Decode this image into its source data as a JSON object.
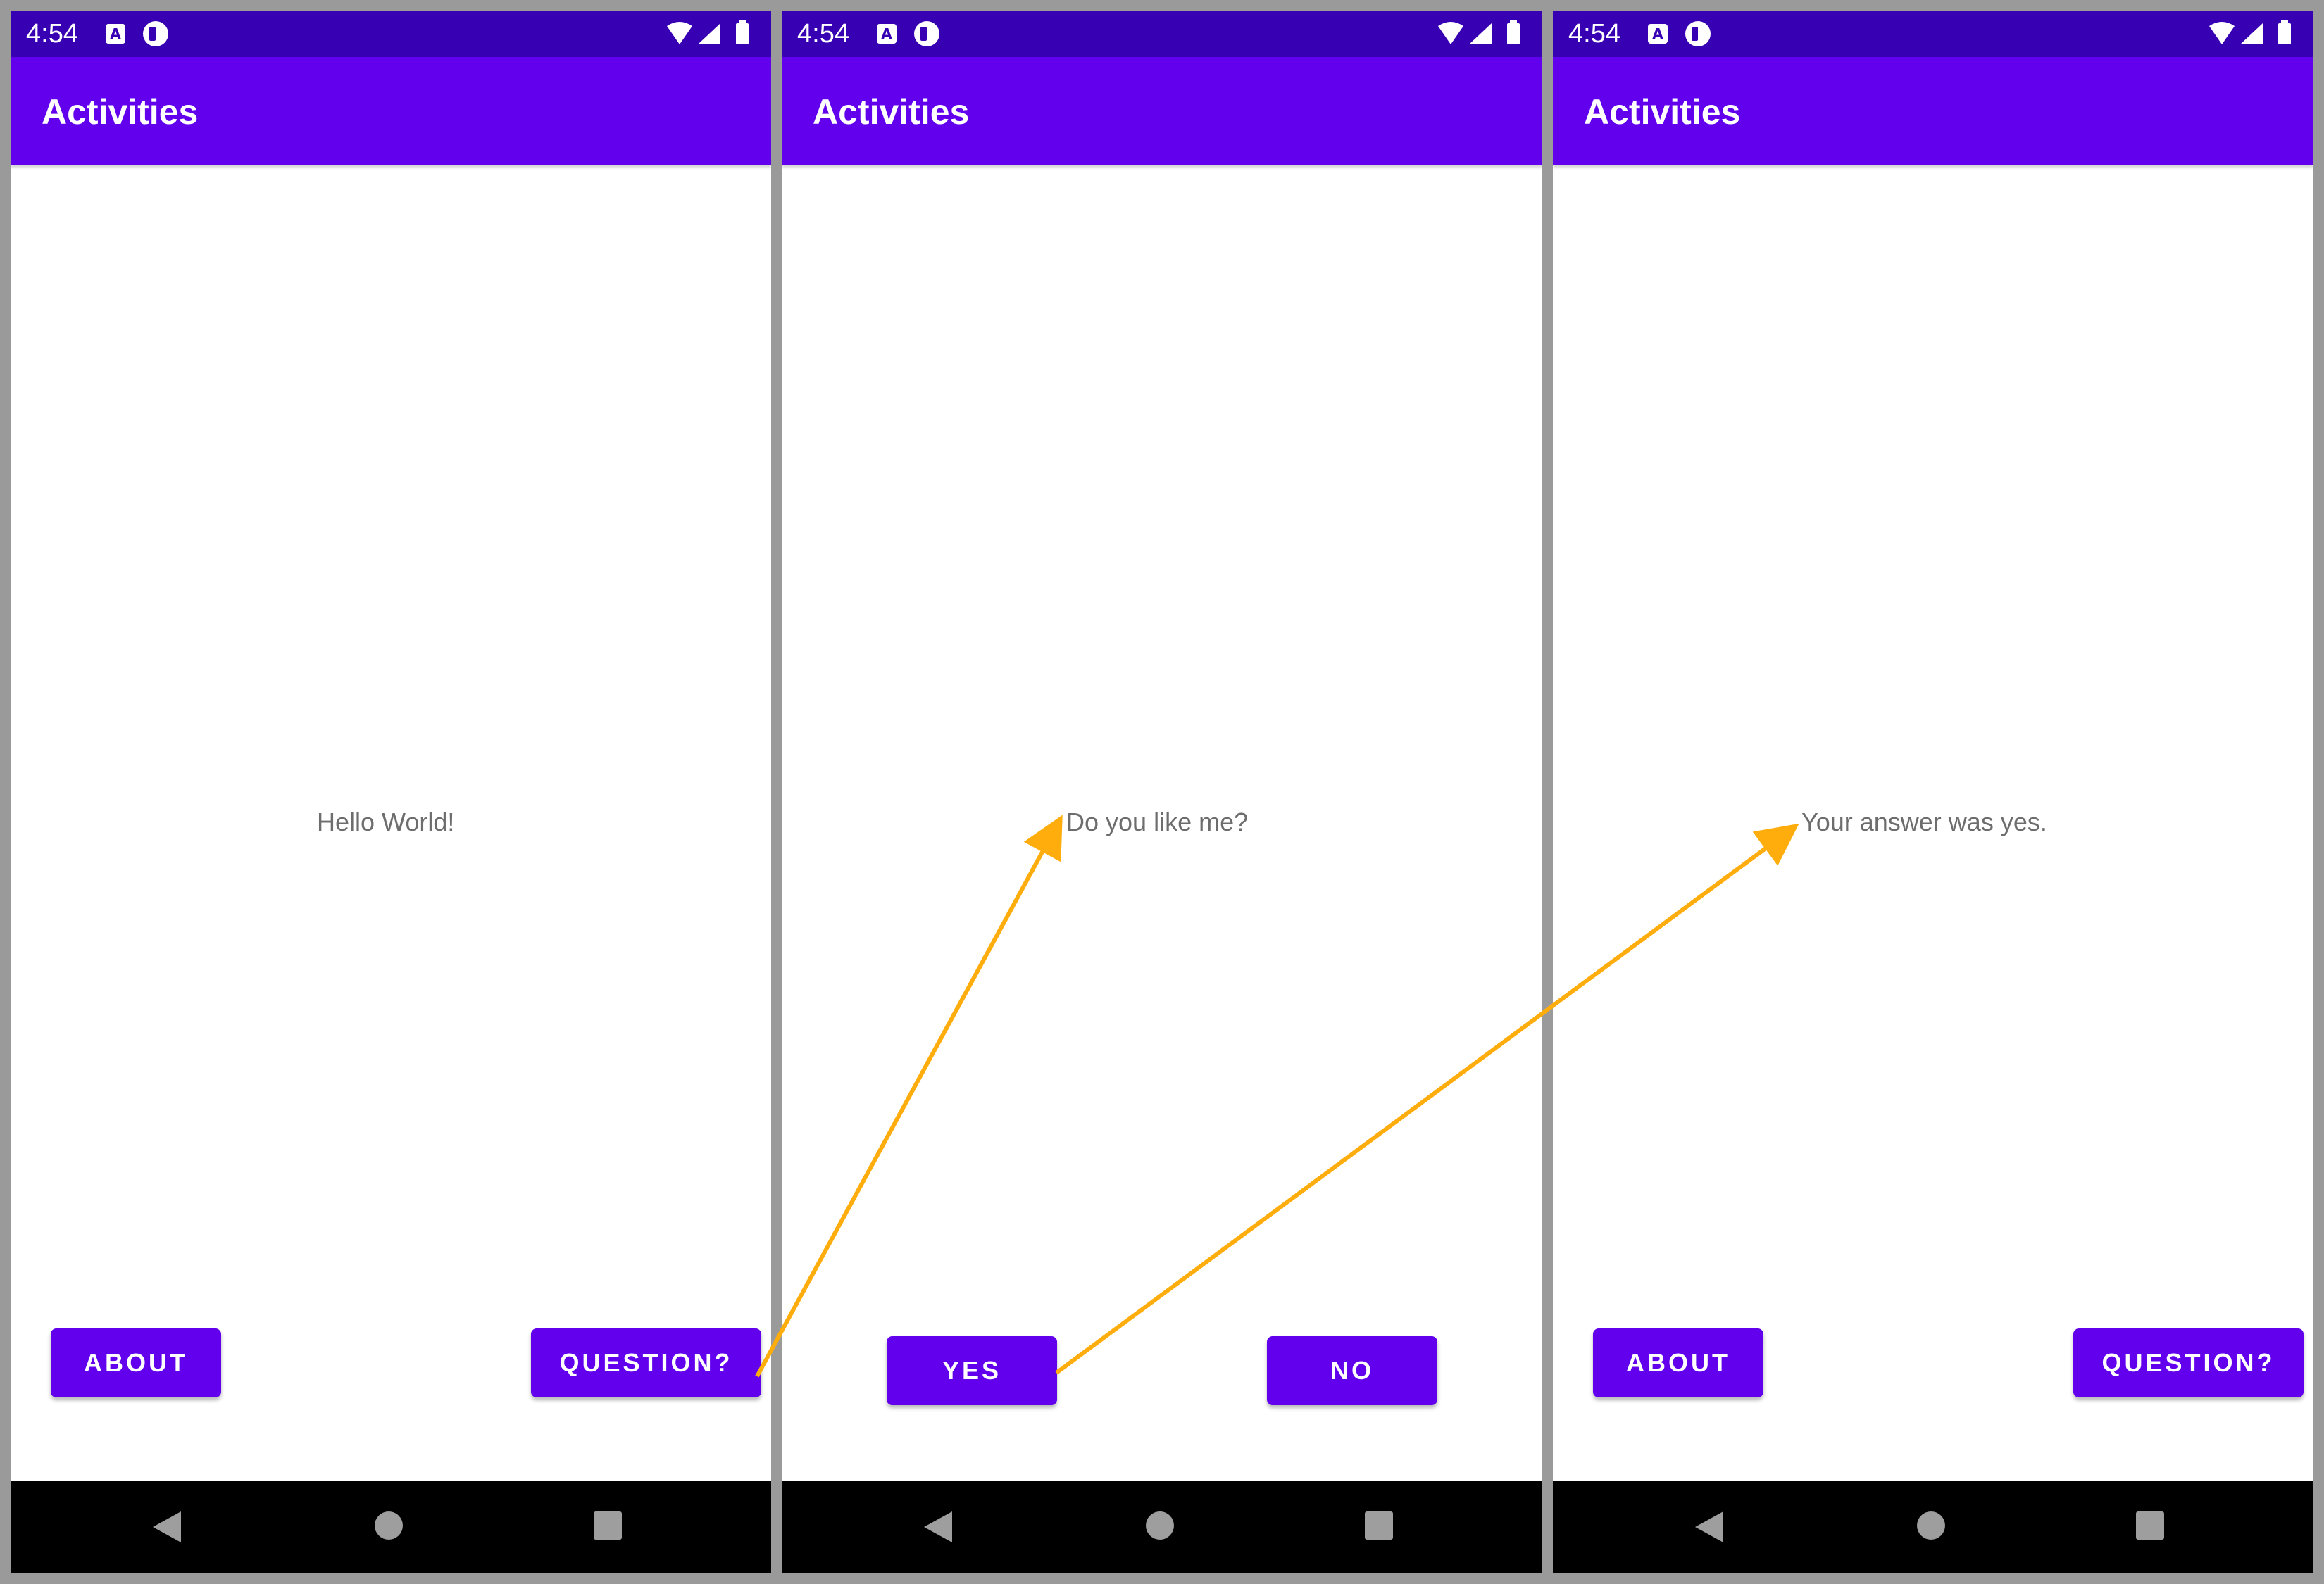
{
  "status_bar": {
    "time": "4:54",
    "notification_icons": [
      "accessibility-a-icon",
      "app-notification-icon"
    ],
    "system_icons": [
      "wifi-icon",
      "cellular-signal-icon",
      "battery-icon"
    ]
  },
  "app_bar": {
    "title": "Activities"
  },
  "screens": [
    {
      "message": "Hello World!",
      "buttons": {
        "left": "ABOUT",
        "right": "QUESTION?"
      }
    },
    {
      "message": "Do you like me?",
      "buttons": {
        "left": "YES",
        "right": "NO"
      }
    },
    {
      "message": "Your answer was yes.",
      "buttons": {
        "left": "ABOUT",
        "right": "QUESTION?"
      }
    }
  ],
  "nav_bar": {
    "icons": [
      "back-icon",
      "home-icon",
      "recents-icon"
    ]
  },
  "colors": {
    "status_bar": "#3700b3",
    "app_bar": "#6200ee",
    "button": "#6200ee",
    "message_text": "#6d6d6d",
    "annotation_arrow": "#ffad0d",
    "frame_background": "#9a9a9a"
  }
}
